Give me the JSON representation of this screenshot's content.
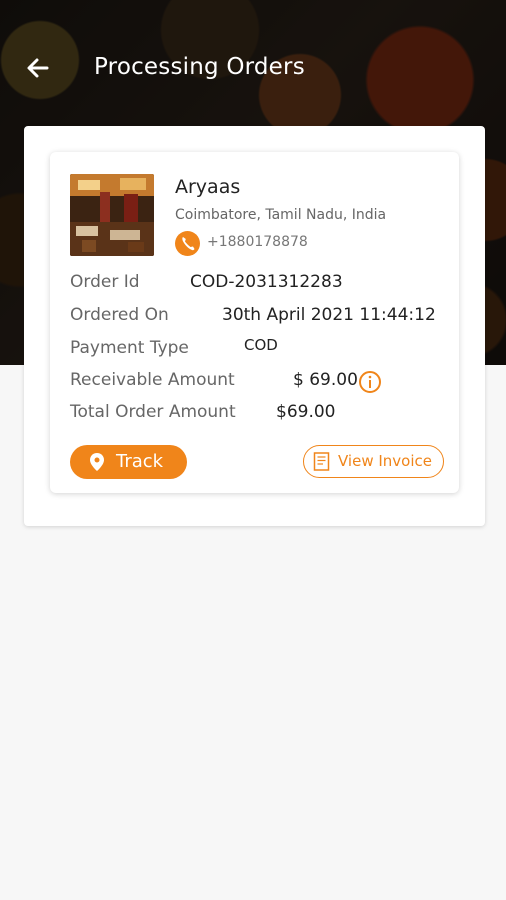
{
  "header": {
    "title": "Processing Orders"
  },
  "restaurant": {
    "name": "Aryaas",
    "location": "Coimbatore, Tamil Nadu, India",
    "phone": "+1880178878"
  },
  "order": {
    "order_id_label": "Order Id",
    "order_id": "COD-2031312283",
    "ordered_on_label": "Ordered On",
    "ordered_on": "30th April 2021 11:44:12",
    "payment_type_label": "Payment Type",
    "payment_type": "COD",
    "receivable_label": "Receivable Amount",
    "receivable": "$ 69.00",
    "total_label": "Total Order Amount",
    "total": "$69.00"
  },
  "actions": {
    "track_label": "Track",
    "invoice_label": "View Invoice"
  },
  "colors": {
    "accent": "#f0851a"
  },
  "icons": [
    "back-arrow-icon",
    "phone-icon",
    "info-icon",
    "location-pin-icon",
    "invoice-icon"
  ]
}
